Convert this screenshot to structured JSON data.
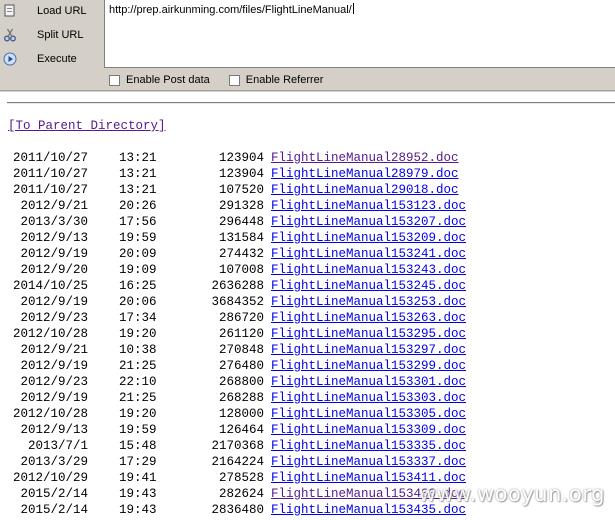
{
  "toolbar": {
    "load_label": "Load URL",
    "split_label": "Split URL",
    "execute_label": "Execute",
    "url_value": "http://prep.airkunming.com/files/FlightLineManual/",
    "post_label": "Enable Post data",
    "referrer_label": "Enable Referrer"
  },
  "listing": {
    "parent_link": "[To Parent Directory]",
    "rows": [
      {
        "date": "2011/10/27",
        "time": "13:21",
        "size": "123904",
        "name": "FlightLineManual28952.doc",
        "visited": true
      },
      {
        "date": "2011/10/27",
        "time": "13:21",
        "size": "123904",
        "name": "FlightLineManual28979.doc",
        "visited": false
      },
      {
        "date": "2011/10/27",
        "time": "13:21",
        "size": "107520",
        "name": "FlightLineManual29018.doc",
        "visited": false
      },
      {
        "date": "2012/9/21",
        "time": "20:26",
        "size": "291328",
        "name": "FlightLineManual153123.doc",
        "visited": false
      },
      {
        "date": "2013/3/30",
        "time": "17:56",
        "size": "296448",
        "name": "FlightLineManual153207.doc",
        "visited": false
      },
      {
        "date": "2012/9/13",
        "time": "19:59",
        "size": "131584",
        "name": "FlightLineManual153209.doc",
        "visited": false
      },
      {
        "date": "2012/9/19",
        "time": "20:09",
        "size": "274432",
        "name": "FlightLineManual153241.doc",
        "visited": false
      },
      {
        "date": "2012/9/20",
        "time": "19:09",
        "size": "107008",
        "name": "FlightLineManual153243.doc",
        "visited": false
      },
      {
        "date": "2014/10/25",
        "time": "16:25",
        "size": "2636288",
        "name": "FlightLineManual153245.doc",
        "visited": false
      },
      {
        "date": "2012/9/19",
        "time": "20:06",
        "size": "3684352",
        "name": "FlightLineManual153253.doc",
        "visited": false
      },
      {
        "date": "2012/9/23",
        "time": "17:34",
        "size": "286720",
        "name": "FlightLineManual153263.doc",
        "visited": false
      },
      {
        "date": "2012/10/28",
        "time": "19:20",
        "size": "261120",
        "name": "FlightLineManual153295.doc",
        "visited": false
      },
      {
        "date": "2012/9/21",
        "time": "10:38",
        "size": "270848",
        "name": "FlightLineManual153297.doc",
        "visited": false
      },
      {
        "date": "2012/9/19",
        "time": "21:25",
        "size": "276480",
        "name": "FlightLineManual153299.doc",
        "visited": false
      },
      {
        "date": "2012/9/23",
        "time": "22:10",
        "size": "268800",
        "name": "FlightLineManual153301.doc",
        "visited": false
      },
      {
        "date": "2012/9/19",
        "time": "21:25",
        "size": "268288",
        "name": "FlightLineManual153303.doc",
        "visited": false
      },
      {
        "date": "2012/10/28",
        "time": "19:20",
        "size": "128000",
        "name": "FlightLineManual153305.doc",
        "visited": false
      },
      {
        "date": "2012/9/13",
        "time": "19:59",
        "size": "126464",
        "name": "FlightLineManual153309.doc",
        "visited": false
      },
      {
        "date": "2013/7/1",
        "time": "15:48",
        "size": "2170368",
        "name": "FlightLineManual153335.doc",
        "visited": false
      },
      {
        "date": "2013/3/29",
        "time": "17:29",
        "size": "2164224",
        "name": "FlightLineManual153337.doc",
        "visited": false
      },
      {
        "date": "2012/10/29",
        "time": "19:41",
        "size": "278528",
        "name": "FlightLineManual153411.doc",
        "visited": false
      },
      {
        "date": "2015/2/14",
        "time": "19:43",
        "size": "282624",
        "name": "FlightLineManual153433.doc",
        "visited": true
      },
      {
        "date": "2015/2/14",
        "time": "19:43",
        "size": "2836480",
        "name": "FlightLineManual153435.doc",
        "visited": false
      }
    ]
  },
  "watermark": "www.wooyun.org",
  "colors": {
    "link": "#0000ee",
    "visited_link": "#551a8b",
    "toolbar_bg": "#d4d0c8"
  },
  "icons": [
    "load-url-icon",
    "split-url-icon",
    "execute-icon"
  ]
}
